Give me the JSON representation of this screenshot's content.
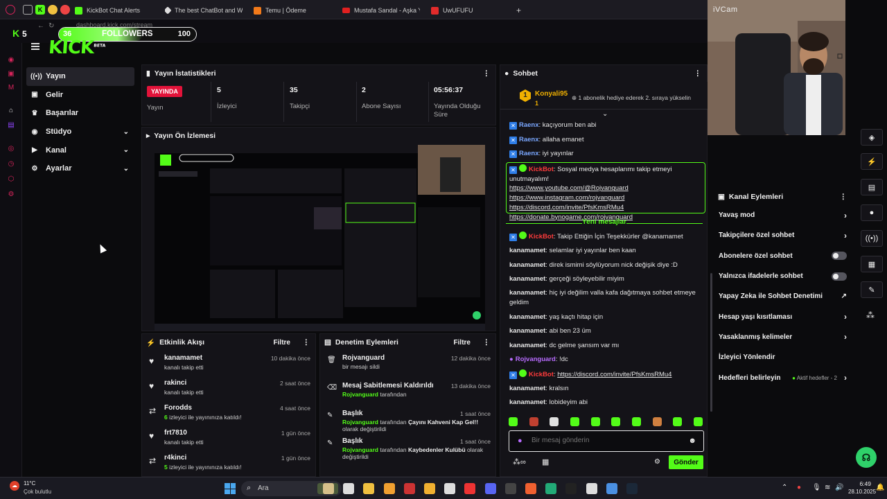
{
  "browser": {
    "tabs": [
      {
        "title": "KickBot Chat Alerts",
        "color": "#53fc18"
      },
      {
        "title": "The best ChatBot and W",
        "color": "#dddddd"
      },
      {
        "title": "Temu | Ödeme",
        "color": "#f27a1a"
      },
      {
        "title": "Mustafa Sandal - Aşka Y",
        "color": "#e02020"
      },
      {
        "title": "UwUFUFU",
        "color": "#e22b2b"
      }
    ],
    "new_tab": "+",
    "url": "dashboard.kick.com/stream"
  },
  "overlay": {
    "logo_count": "5",
    "followers_current": "36",
    "followers_label": "FOLLOWERS",
    "followers_goal": "100",
    "progress_fraction": 0.36,
    "kick_logo": "KICK",
    "beta": "BETA",
    "camera_label": "iVCam"
  },
  "sidebar": {
    "items": [
      {
        "label": "Yayın",
        "icon": "broadcast-icon",
        "active": true
      },
      {
        "label": "Gelir",
        "icon": "revenue-icon"
      },
      {
        "label": "Başarılar",
        "icon": "trophy-icon"
      },
      {
        "label": "Stüdyo",
        "icon": "studio-icon",
        "chevron": true
      },
      {
        "label": "Kanal",
        "icon": "channel-icon",
        "chevron": true
      },
      {
        "label": "Ayarlar",
        "icon": "settings-icon",
        "chevron": true
      }
    ]
  },
  "stats": {
    "title": "Yayın İstatistikleri",
    "live_badge": "YAYINDA",
    "live_label": "Yayın",
    "cells": [
      {
        "value": "5",
        "label": "İzleyici"
      },
      {
        "value": "35",
        "label": "Takipçi"
      },
      {
        "value": "2",
        "label": "Abone Sayısı"
      },
      {
        "value": "05:56:37",
        "label": "Yayında Olduğu Süre"
      }
    ]
  },
  "preview": {
    "title": "Yayın Ön İzlemesi"
  },
  "activity": {
    "title": "Etkinlik Akışı",
    "filter": "Filtre",
    "items": [
      {
        "icon": "heart-icon",
        "user": "kanamamet",
        "text": "kanalı takip etti",
        "time": "10 dakika önce"
      },
      {
        "icon": "heart-icon",
        "user": "rakinci",
        "text": "kanalı takip etti",
        "time": "2 saat önce"
      },
      {
        "icon": "raid-icon",
        "user": "Forodds",
        "count": "6",
        "text": "izleyici ile yayınınıza katıldı!",
        "time": "4 saat önce"
      },
      {
        "icon": "heart-icon",
        "user": "frt7810",
        "text": "kanalı takip etti",
        "time": "1 gün önce"
      },
      {
        "icon": "raid-icon",
        "user": "r4kinci",
        "count": "5",
        "text": "izleyici ile yayınınıza katıldı!",
        "time": "1 gün önce"
      }
    ]
  },
  "moderation": {
    "title": "Denetim Eylemleri",
    "filter": "Filtre",
    "items": [
      {
        "icon": "trash-icon",
        "title": "Rojvanguard",
        "line1": "bir mesajı sildi",
        "time": "12 dakika önce"
      },
      {
        "icon": "unpin-icon",
        "title": "Mesaj Sabitlemesi Kaldırıldı",
        "actor": "Rojvanguard",
        "line1": "tarafından",
        "time": "13 dakika önce"
      },
      {
        "icon": "title-icon",
        "title": "Başlık",
        "actor": "Rojvanguard",
        "line1": "tarafından",
        "bold": "Çayını Kahveni Kap Gel!!",
        "line2": "olarak değiştirildi",
        "time": "1 saat önce"
      },
      {
        "icon": "title-icon",
        "title": "Başlık",
        "actor": "Rojvanguard",
        "line1": "tarafından",
        "bold": "Kaybedenler Kulübü",
        "line2": "olarak değiştirildi",
        "time": "1 saat önce"
      }
    ]
  },
  "chat": {
    "title": "Sohbet",
    "pinned": {
      "user": "Konyali95",
      "level": "1",
      "text": "1 abonelik hediye ederek 2. sıraya yükselin"
    },
    "messages": [
      {
        "user": "Raenx",
        "text": "kaçıyorum ben abi",
        "color": "#7aa7ff"
      },
      {
        "user": "Raenx",
        "text": "allaha emanet",
        "color": "#7aa7ff"
      },
      {
        "user": "Raenx",
        "text": "iyi yayınlar",
        "color": "#7aa7ff"
      }
    ],
    "system": {
      "user": "KickBot",
      "text": "Sosyal medya hesaplarımı takip etmeyi unutmayalım!",
      "links": [
        "https://www.youtube.com/@Rojvanguard",
        "https://www.instagram.com/rojvanguard",
        "https://discord.com/invite/PfsKmsRMu4",
        "https://donate.bynogame.com/rojvanguard"
      ]
    },
    "new_messages": "Yeni mesajlar",
    "messages2": [
      {
        "user": "KickBot",
        "text": "Takip Ettiğin İçin Teşekkürler @kanamamet",
        "color": "#ff3b3b"
      },
      {
        "user": "kanamamet",
        "text": "selamlar iyi yayınlar ben kaan"
      },
      {
        "user": "kanamamet",
        "text": "direk ismimi söylüyorum nick değişik diye :D"
      },
      {
        "user": "kanamamet",
        "text": "gerçeği söyleyebilir miyim"
      },
      {
        "user": "kanamamet",
        "text": "hiç iyi değilim valla kafa dağıtmaya sohbet etmeye geldim"
      },
      {
        "user": "kanamamet",
        "text": "yaş kaçtı hitap için"
      },
      {
        "user": "kanamamet",
        "text": "abi ben 23 üm"
      },
      {
        "user": "kanamamet",
        "text": "dc gelme şansım var mı"
      },
      {
        "user": "Rojvanguard",
        "text": "!dc",
        "color": "#b86cff"
      },
      {
        "user": "KickBot",
        "text": "https://discord.com/invite/PfsKmsRMu4",
        "color": "#ff3b3b"
      },
      {
        "user": "kanamamet",
        "text": "kralsın"
      },
      {
        "user": "kanamamet",
        "text": "lobideyim abi"
      }
    ],
    "input_placeholder": "Bir mesaj gönderin",
    "send_label": "Gönder"
  },
  "channel_actions": {
    "title": "Kanal Eylemleri",
    "items": [
      {
        "label": "Yavaş mod",
        "type": "chevron"
      },
      {
        "label": "Takipçilere özel sohbet",
        "type": "chevron"
      },
      {
        "label": "Abonelere özel sohbet",
        "type": "toggle"
      },
      {
        "label": "Yalnızca ifadelerle sohbet",
        "type": "toggle"
      },
      {
        "label": "Yapay Zeka ile Sohbet Denetimi",
        "type": "external"
      },
      {
        "label": "Hesap yaşı kısıtlaması",
        "type": "chevron"
      },
      {
        "label": "Yasaklanmış kelimeler",
        "type": "chevron"
      },
      {
        "label": "İzleyici Yönlendir",
        "type": "none"
      },
      {
        "label": "Hedefleri belirleyin",
        "type": "chevron",
        "extra": "Aktif hedefler - 2"
      }
    ]
  },
  "taskbar": {
    "weather_temp": "11°C",
    "weather_text": "Çok bulutlu",
    "search": "Ara",
    "time": "6:49",
    "date": "28.10.2025"
  }
}
